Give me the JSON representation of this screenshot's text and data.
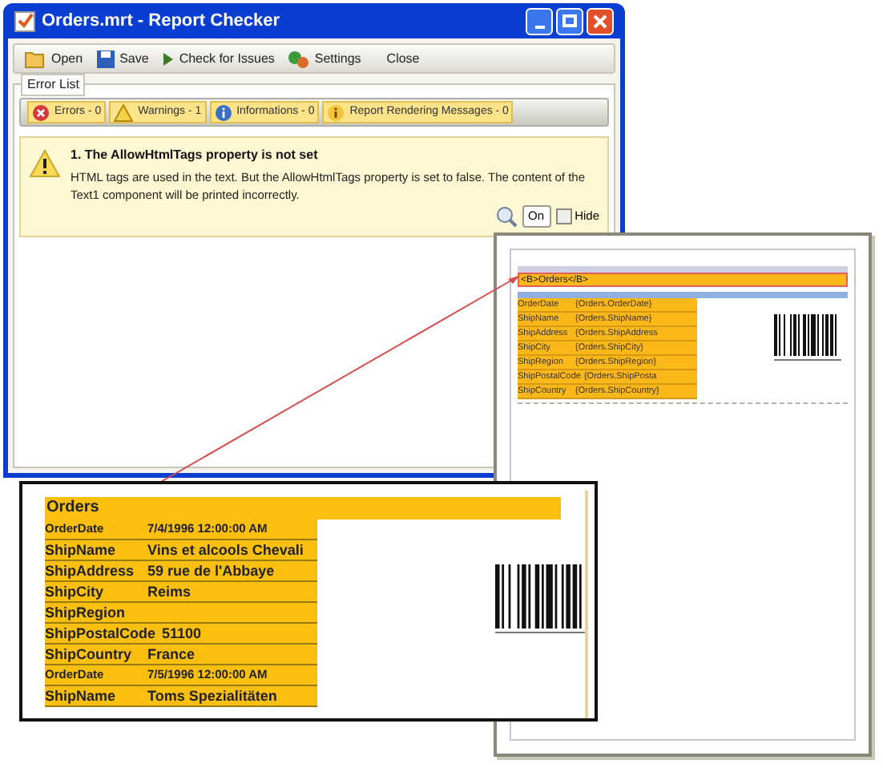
{
  "window": {
    "title": "Orders.mrt - Report Checker"
  },
  "toolbar": [
    {
      "kind": "open",
      "label": "Open"
    },
    {
      "kind": "save",
      "label": "Save"
    },
    {
      "kind": "check",
      "label": "Check for Issues"
    },
    {
      "kind": "settings",
      "label": "Settings"
    },
    {
      "kind": "close",
      "label": "Close"
    }
  ],
  "error_list": {
    "title": "Error List",
    "filters": [
      {
        "kind": "error",
        "label": "Errors - 0"
      },
      {
        "kind": "warning",
        "label": "Warnings - 1"
      },
      {
        "kind": "info",
        "label": "Informations - 0"
      },
      {
        "kind": "render",
        "label": "Report Rendering Messages - 0"
      }
    ],
    "messages": [
      {
        "title": "1. The AllowHtmlTags property is not set",
        "text": "HTML tags are used in the text. But the AllowHtmlTags property is set to false. The content of the Text1 component will be printed incorrectly.",
        "action": "On",
        "hide_label": "Hide",
        "hide_checked": false
      }
    ]
  },
  "report_page": {
    "title_text": "<B>Orders</B>",
    "fields": [
      {
        "label": "OrderDate",
        "expression": "{Orders.OrderDate}"
      },
      {
        "label": "ShipName",
        "expression": "{Orders.ShipName}"
      },
      {
        "label": "ShipAddress",
        "expression": "{Orders.ShipAddress"
      },
      {
        "label": "ShipCity",
        "expression": "{Orders.ShipCity}"
      },
      {
        "label": "ShipRegion",
        "expression": "{Orders.ShipRegion}"
      },
      {
        "label": "ShipPostalCode",
        "expression": "{Orders.ShipPosta"
      },
      {
        "label": "ShipCountry",
        "expression": "{Orders.ShipCountry}"
      }
    ]
  },
  "preview": {
    "title": "Orders",
    "rows": [
      {
        "kind": "small",
        "label": "OrderDate",
        "value": "7/4/1996 12:00:00 AM"
      },
      {
        "kind": "large",
        "label": "ShipName",
        "value": "Vins et alcools Chevali"
      },
      {
        "kind": "large",
        "label": "ShipAddress",
        "value": "59 rue de l'Abbaye"
      },
      {
        "kind": "large",
        "label": "ShipCity",
        "value": "Reims"
      },
      {
        "kind": "large",
        "label": "ShipRegion"
      },
      {
        "kind": "large",
        "label": "ShipPostalCode",
        "value": "51100"
      },
      {
        "kind": "large",
        "label": "ShipCountry",
        "value": "France"
      },
      {
        "kind": "small",
        "label": "OrderDate",
        "value": "7/5/1996 12:00:00 AM"
      },
      {
        "kind": "large",
        "label": "ShipName",
        "value": "Toms Spezialitäten"
      }
    ]
  }
}
